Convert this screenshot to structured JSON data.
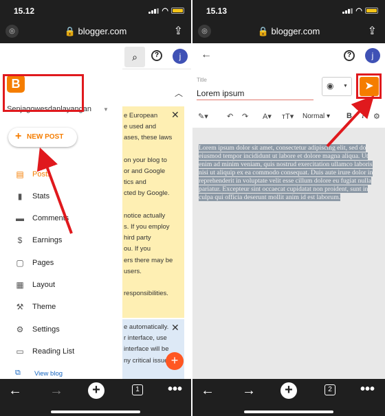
{
  "left": {
    "status": {
      "time": "15.12"
    },
    "url": "blogger.com",
    "blog_name": "Senjagowesdanlayangan",
    "new_post_label": "NEW POST",
    "nav": [
      {
        "icon": "posts-icon",
        "label": "Posts"
      },
      {
        "icon": "stats-icon",
        "label": "Stats"
      },
      {
        "icon": "comments-icon",
        "label": "Comments"
      },
      {
        "icon": "earnings-icon",
        "label": "Earnings"
      },
      {
        "icon": "pages-icon",
        "label": "Pages"
      },
      {
        "icon": "layout-icon",
        "label": "Layout"
      },
      {
        "icon": "theme-icon",
        "label": "Theme"
      },
      {
        "icon": "settings-icon",
        "label": "Settings"
      },
      {
        "icon": "reading-list-icon",
        "label": "Reading List"
      }
    ],
    "view_blog": "View blog",
    "avatar": "j",
    "notice1_lines": [
      "e European",
      "e used and",
      "ases, these laws",
      "",
      "on your blog to",
      "or and Google",
      "tics and",
      "cted by Google.",
      "",
      "notice actually",
      "s. If you employ",
      "hird party",
      "ou. If you",
      "ers there may be",
      "users.",
      "",
      "responsibilities."
    ],
    "notice2_lines": [
      "e automatically.",
      "r interface, use",
      "interface will be",
      "ny critical issue"
    ],
    "tab_count": "1"
  },
  "right": {
    "status": {
      "time": "15.13"
    },
    "url": "blogger.com",
    "avatar": "j",
    "title_label": "Title",
    "title_value": "Lorem ipsum",
    "format_label": "Normal",
    "body": "Lorem ipsum dolor sit amet, consectetur adipiscing elit, sed do eiusmod tempor incididunt ut labore et dolore magna aliqua. Ut enim ad minim veniam, quis nostrud exercitation ullamco laboris nisi ut aliquip ex ea commodo consequat. Duis aute irure dolor in reprehenderit in voluptate velit esse cillum dolore eu fugiat nulla pariatur. Excepteur sint occaecat cupidatat non proident, sunt in culpa qui officia deserunt mollit anim id est laborum.",
    "tab_count": "2"
  },
  "colors": {
    "accent": "#f57d00",
    "highlight": "#e0191d",
    "avatar": "#3f51b5",
    "fab": "#ff5722"
  }
}
